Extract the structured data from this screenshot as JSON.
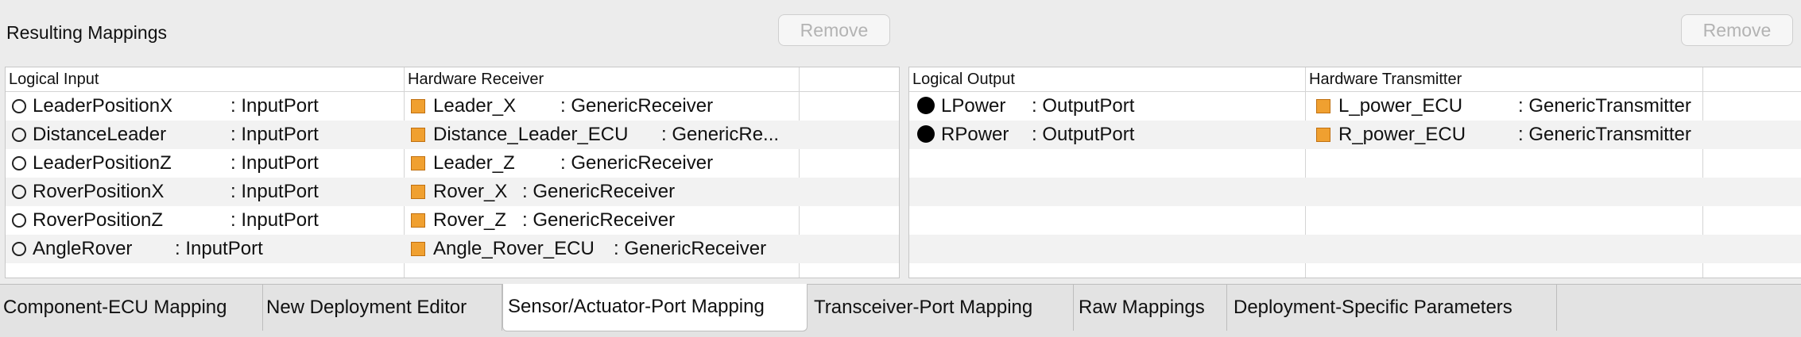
{
  "header": {
    "title": "Resulting Mappings",
    "remove_label": "Remove"
  },
  "left_table": {
    "columns": [
      "Logical Input",
      "Hardware Receiver"
    ],
    "rows": [
      {
        "input": "LeaderPositionX",
        "input_type": ": InputPort",
        "hw": "Leader_X",
        "hw_type": ": GenericReceiver"
      },
      {
        "input": "DistanceLeader",
        "input_type": ": InputPort",
        "hw": "Distance_Leader_ECU",
        "hw_type": ": GenericRe..."
      },
      {
        "input": "LeaderPositionZ",
        "input_type": ": InputPort",
        "hw": "Leader_Z",
        "hw_type": ": GenericReceiver"
      },
      {
        "input": "RoverPositionX",
        "input_type": ": InputPort",
        "hw": "Rover_X",
        "hw_type": ": GenericReceiver"
      },
      {
        "input": "RoverPositionZ",
        "input_type": ": InputPort",
        "hw": "Rover_Z",
        "hw_type": ": GenericReceiver"
      },
      {
        "input": "AngleRover",
        "input_type": ": InputPort",
        "hw": "Angle_Rover_ECU",
        "hw_type": ": GenericReceiver"
      }
    ]
  },
  "right_table": {
    "columns": [
      "Logical Output",
      "Hardware Transmitter"
    ],
    "rows": [
      {
        "output": "LPower",
        "output_type": ": OutputPort",
        "hw": "L_power_ECU",
        "hw_type": ": GenericTransmitter"
      },
      {
        "output": "RPower",
        "output_type": ": OutputPort",
        "hw": "R_power_ECU",
        "hw_type": ": GenericTransmitter"
      }
    ]
  },
  "tabs": [
    {
      "label": "Component-ECU Mapping"
    },
    {
      "label": "New Deployment Editor"
    },
    {
      "label": "Sensor/Actuator-Port Mapping",
      "active": true
    },
    {
      "label": "Transceiver-Port Mapping"
    },
    {
      "label": "Raw Mappings"
    },
    {
      "label": "Deployment-Specific Parameters"
    }
  ],
  "icons": {
    "input_port": "hollow-circle-icon",
    "output_port": "filled-circle-icon",
    "hardware": "orange-square-icon"
  },
  "colors": {
    "hardware_icon": "#f0a030",
    "selected_tab": "#ffffff"
  }
}
